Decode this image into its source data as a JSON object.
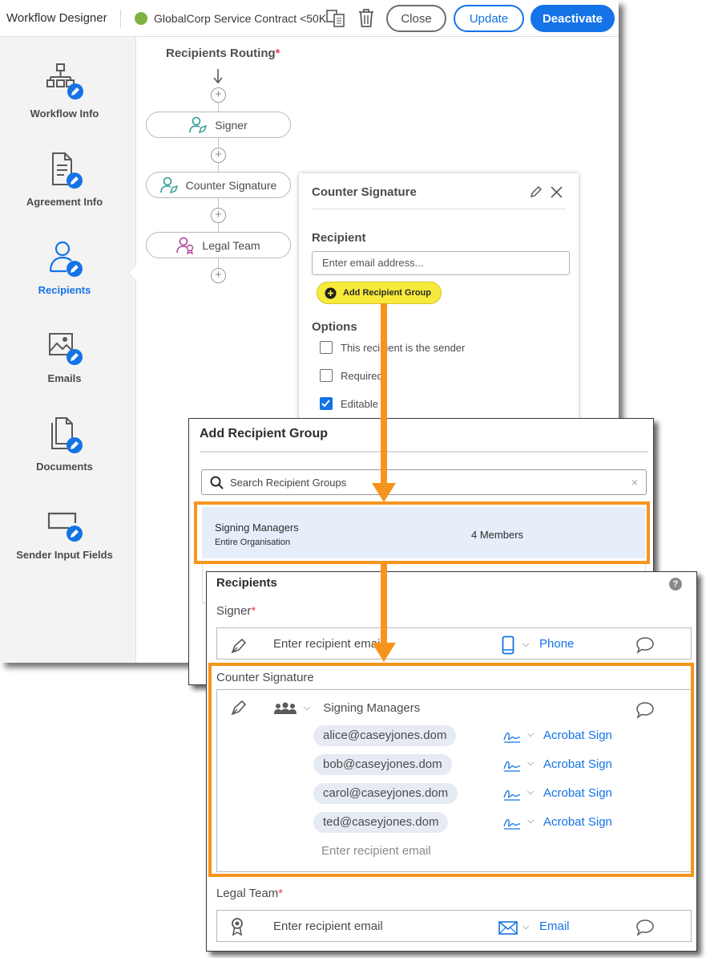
{
  "header": {
    "app_title": "Workflow Designer",
    "workflow_name": "GlobalCorp Service Contract <50K",
    "status_color": "#7cb342",
    "buttons": {
      "close": "Close",
      "update": "Update",
      "deactivate": "Deactivate"
    },
    "icons": [
      "copy-icon",
      "trash-icon"
    ]
  },
  "sidebar": {
    "items": [
      {
        "label": "Workflow Info",
        "icon": "workflow-icon",
        "active": false
      },
      {
        "label": "Agreement Info",
        "icon": "document-edit-icon",
        "active": false
      },
      {
        "label": "Recipients",
        "icon": "user-icon",
        "active": true
      },
      {
        "label": "Emails",
        "icon": "image-icon",
        "active": false
      },
      {
        "label": "Documents",
        "icon": "documents-icon",
        "active": false
      },
      {
        "label": "Sender Input Fields",
        "icon": "input-field-icon",
        "active": false
      }
    ]
  },
  "routing": {
    "title": "Recipients Routing",
    "required_mark": "*",
    "nodes": [
      {
        "label": "Signer",
        "icon": "signer-icon"
      },
      {
        "label": "Counter Signature",
        "icon": "signer-icon"
      },
      {
        "label": "Legal Team",
        "icon": "seal-icon"
      }
    ]
  },
  "panel": {
    "title": "Counter Signature",
    "recipient_label": "Recipient",
    "email_placeholder": "Enter email address...",
    "add_group_button": "Add Recipient Group",
    "options_label": "Options",
    "options": [
      {
        "label": "This recipient is the sender",
        "checked": false
      },
      {
        "label": "Required",
        "checked": false
      },
      {
        "label": "Editable",
        "checked": true
      }
    ]
  },
  "group_dialog": {
    "title": "Add Recipient Group",
    "search_placeholder": "Search Recipient Groups",
    "clear": "×",
    "groups": [
      {
        "name": "Signing Managers",
        "scope": "Entire Organisation",
        "members": "4 Members"
      }
    ]
  },
  "recipients_form": {
    "title": "Recipients",
    "help": "?",
    "signer": {
      "label": "Signer",
      "required": "*",
      "email_placeholder": "Enter recipient email",
      "method": "Phone"
    },
    "counter_signature": {
      "label": "Counter Signature",
      "group_name": "Signing Managers",
      "members": [
        {
          "email": "alice@caseyjones.dom",
          "method": "Acrobat Sign"
        },
        {
          "email": "bob@caseyjones.dom",
          "method": "Acrobat Sign"
        },
        {
          "email": "carol@caseyjones.dom",
          "method": "Acrobat Sign"
        },
        {
          "email": "ted@caseyjones.dom",
          "method": "Acrobat Sign"
        }
      ],
      "email_placeholder": "Enter recipient email"
    },
    "legal_team": {
      "label": "Legal Team",
      "required": "*",
      "email_placeholder": "Enter recipient email",
      "method": "Email"
    }
  },
  "colors": {
    "accent": "#1473e6",
    "highlight": "#f7941d",
    "button_highlight": "#f7ea3a",
    "required": "#e34850"
  }
}
